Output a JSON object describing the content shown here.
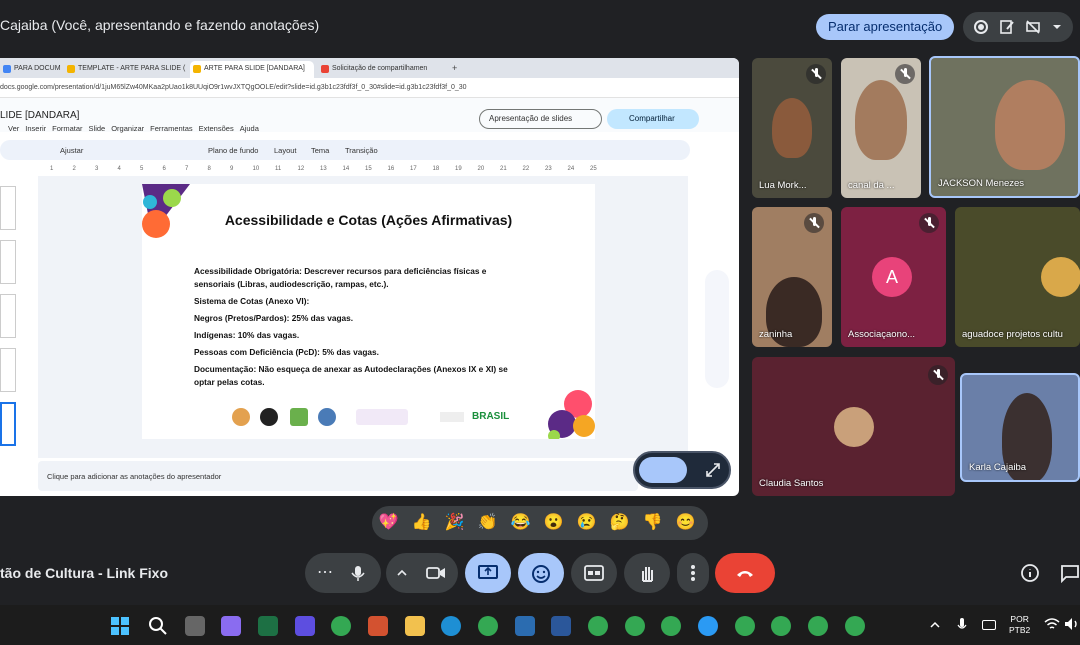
{
  "meeting": {
    "presenting_title": "Cajaiba (Você, apresentando e fazendo anotações)",
    "stop_presenting": "Parar apresentação",
    "meeting_name": "tão de Cultura - Link Fixo"
  },
  "browser": {
    "tabs": [
      {
        "label": "PARA DOCUM"
      },
      {
        "label": "TEMPLATE - ARTE PARA SLIDE ("
      },
      {
        "label": "ARTE PARA SLIDE [DANDARA]"
      },
      {
        "label": "Solicitação de compartilhamen"
      }
    ],
    "url": "docs.google.com/presentation/d/1juM65lZw40MKaa2pUao1k8UUqiO9r1wvJXTQgOOLE/edit?slide=id.g3b1c23fdf3f_0_30#slide=id.g3b1c23fdf3f_0_30"
  },
  "slides_app": {
    "doc_title": "LIDE [DANDARA]",
    "menus": [
      "Ver",
      "Inserir",
      "Formatar",
      "Slide",
      "Organizar",
      "Ferramentas",
      "Extensões",
      "Ajuda"
    ],
    "slideshow_label": "Apresentação de slides",
    "share_label": "Compartilhar",
    "toolbar": {
      "zoom": "Ajustar",
      "background": "Plano de fundo",
      "layout": "Layout",
      "theme": "Tema",
      "transition": "Transição"
    },
    "ruler_ticks": [
      "1",
      "2",
      "3",
      "4",
      "5",
      "6",
      "7",
      "8",
      "9",
      "10",
      "11",
      "12",
      "13",
      "14",
      "15",
      "16",
      "17",
      "18",
      "19",
      "20",
      "21",
      "22",
      "23",
      "24",
      "25"
    ],
    "notes_placeholder": "Clique para adicionar as anotações do apresentador",
    "slide": {
      "title": "Acessibilidade e Cotas (Ações Afirmativas)",
      "lines": [
        "Acessibilidade Obrigatória: Descrever recursos para deficiências físicas e sensoriais (Libras, audiodescrição, rampas, etc.).",
        "Sistema de Cotas (Anexo VI):",
        "Negros (Pretos/Pardos): 25% das vagas.",
        "Indígenas: 10% das vagas.",
        "Pessoas com Deficiência (PcD): 5% das vagas.",
        "Documentação: Não esqueça de anexar as Autodeclarações (Anexos IX e XI) se optar pelas cotas."
      ],
      "footer_brand": "BRASIL"
    }
  },
  "participants": [
    {
      "name": "Lua Mork..."
    },
    {
      "name": "canal da ..."
    },
    {
      "name": "JACKSON Menezes"
    },
    {
      "name": "zaninha"
    },
    {
      "name": "Associaçaono...",
      "initial": "A"
    },
    {
      "name": "aguadoce projetos cultu"
    },
    {
      "name": "Claudia Santos"
    },
    {
      "name": "Karla Cajaiba"
    }
  ],
  "reactions": [
    "💖",
    "👍",
    "🎉",
    "👏",
    "😂",
    "😮",
    "😢",
    "🤔",
    "👎",
    "😊"
  ],
  "taskbar": {
    "lang_top": "POR",
    "lang_bottom": "PTB2"
  },
  "colors": {
    "accent": "#a8c7fa",
    "end_call": "#ea4335",
    "assoc_tile": "#7d2142",
    "claudia_tile": "#5a2230"
  }
}
